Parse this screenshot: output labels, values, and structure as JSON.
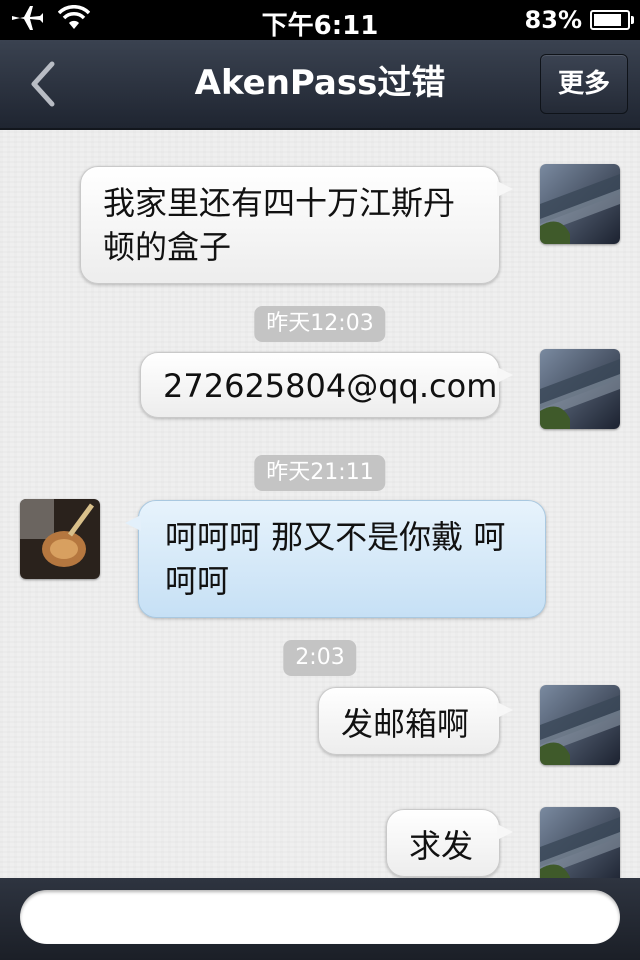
{
  "status_bar": {
    "time": "下午6:11",
    "battery": "83%",
    "battery_level": 0.83,
    "icons": [
      "airplane-icon",
      "wifi-icon",
      "battery-icon"
    ]
  },
  "nav": {
    "title": "AkenPass过错",
    "back_icon": "chevron-left-icon",
    "more_label": "更多"
  },
  "messages": [
    {
      "type": "message",
      "direction": "out",
      "text": "我家里还有四十万江斯丹顿的盒子"
    },
    {
      "type": "timestamp",
      "text": "昨天12:03"
    },
    {
      "type": "message",
      "direction": "out",
      "text": "272625804@qq.com"
    },
    {
      "type": "timestamp",
      "text": "昨天21:11"
    },
    {
      "type": "message",
      "direction": "in",
      "text": "呵呵呵 那又不是你戴 呵呵呵"
    },
    {
      "type": "timestamp",
      "text": "2:03"
    },
    {
      "type": "message",
      "direction": "out",
      "text": "发邮箱啊"
    },
    {
      "type": "message",
      "direction": "out",
      "text": "求发"
    }
  ],
  "input": {
    "value": "",
    "placeholder": ""
  },
  "colors": {
    "nav_bg": "#2a313d",
    "incoming_bubble": "#c6e0f5",
    "outgoing_bubble": "#f2f2f2",
    "timestamp_bg": "#c4c4c4"
  }
}
